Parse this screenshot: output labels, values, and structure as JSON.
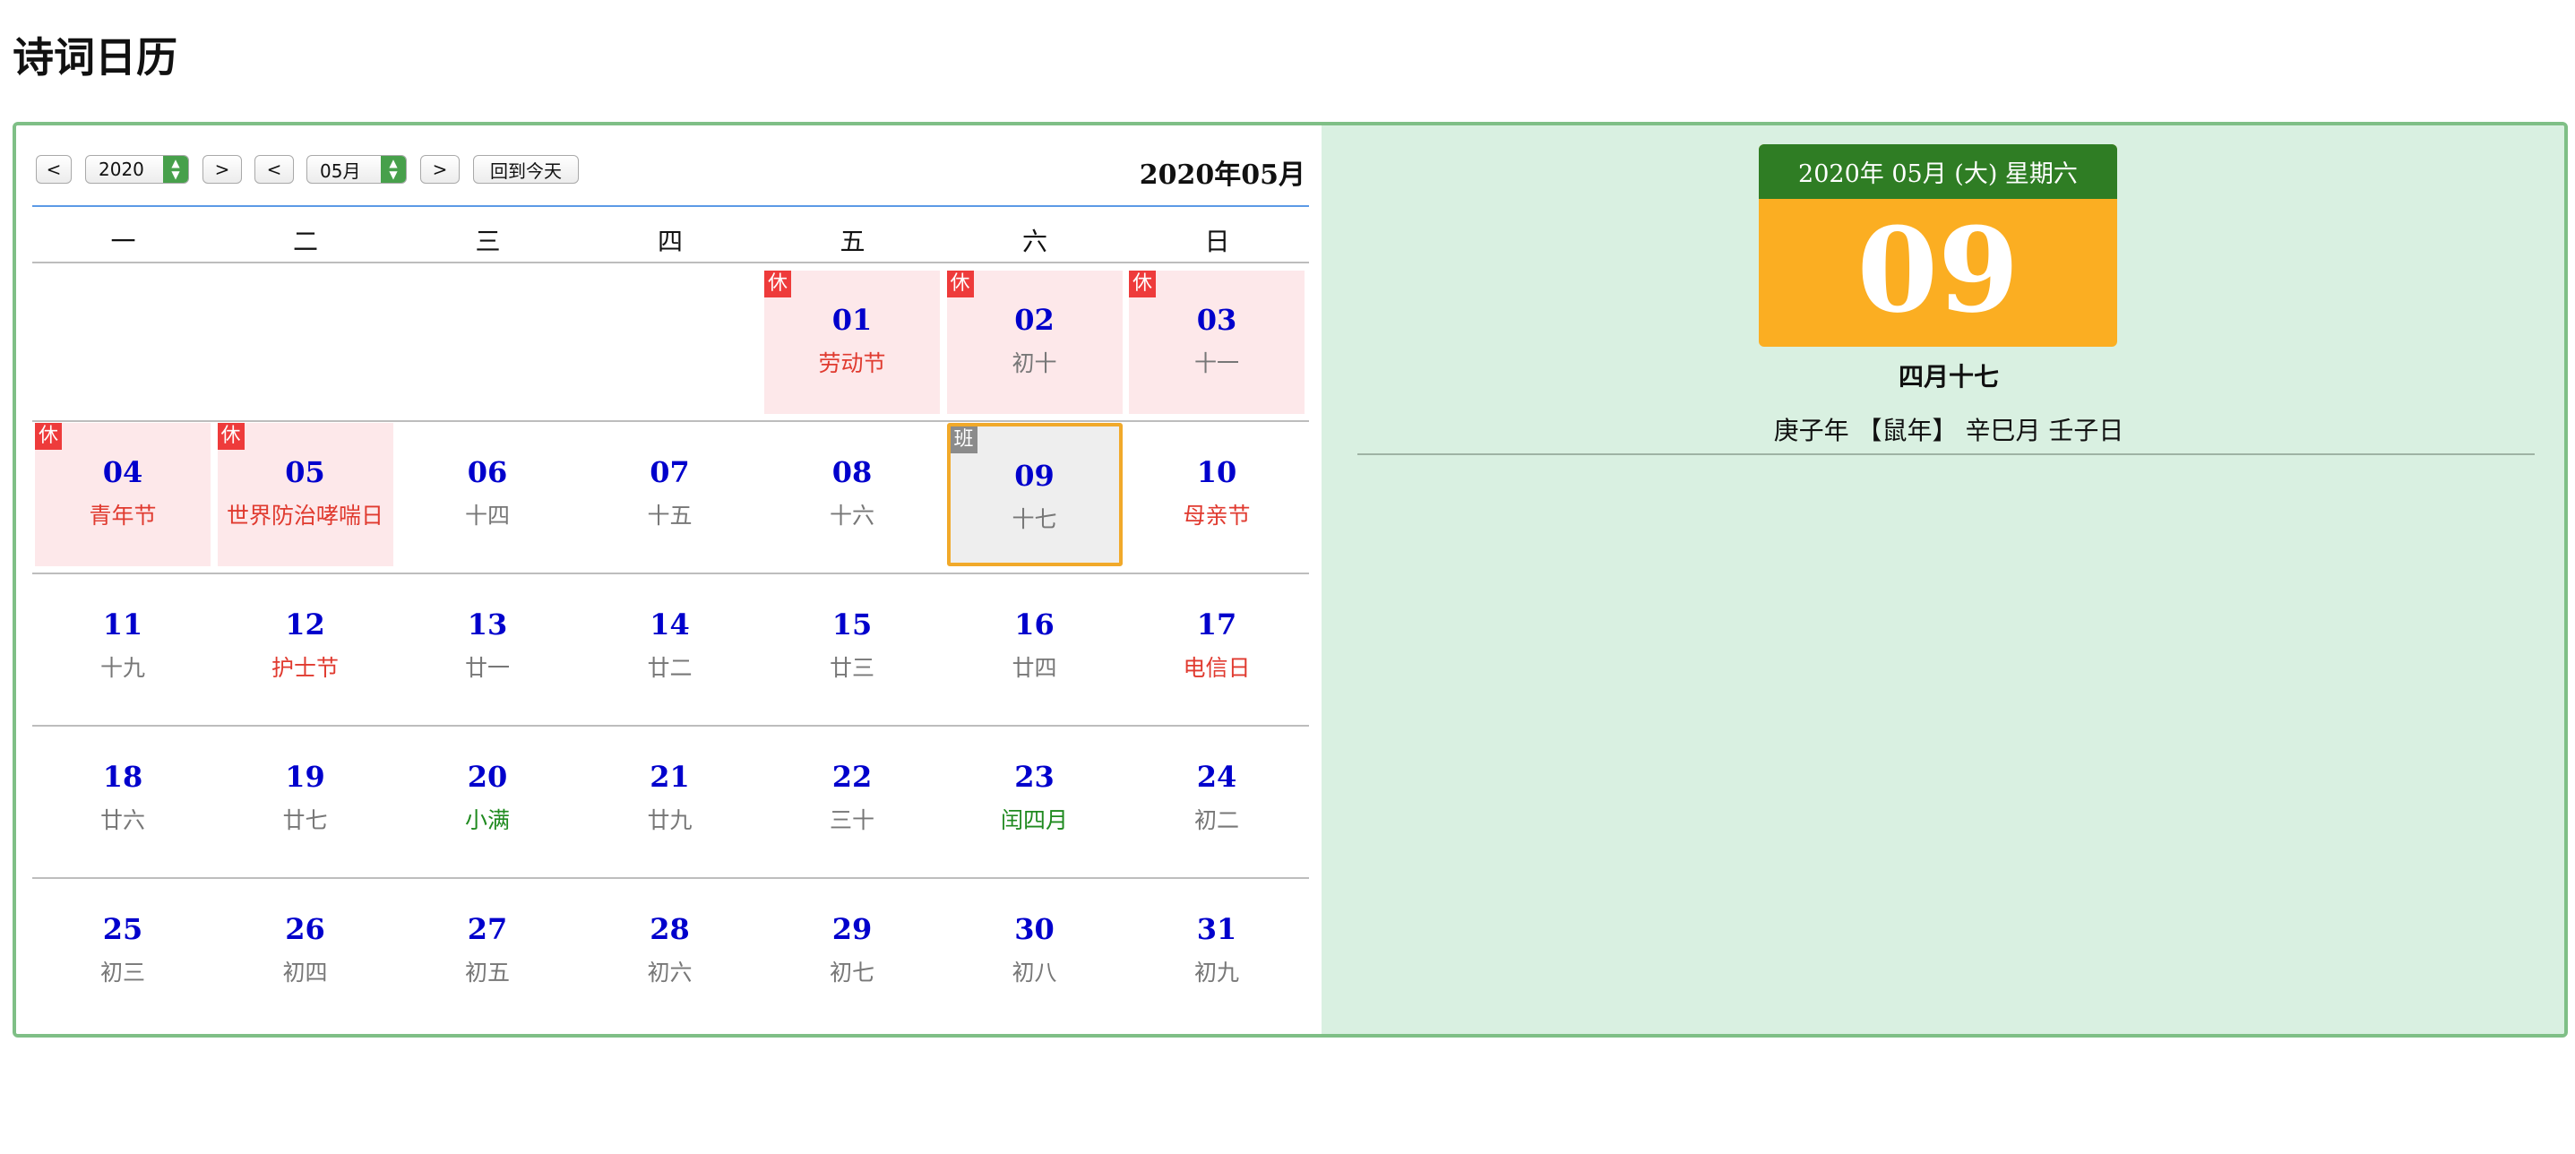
{
  "page": {
    "title": "诗词日历"
  },
  "toolbar": {
    "prev_year": "<",
    "year_value": "2020",
    "next_year": ">",
    "prev_month": "<",
    "month_value": "05月",
    "next_month": ">",
    "today_button": "回到今天"
  },
  "calendar": {
    "month_title": "2020年05月",
    "weekdays": [
      "一",
      "二",
      "三",
      "四",
      "五",
      "六",
      "日"
    ],
    "weeks": [
      [
        null,
        null,
        null,
        null,
        {
          "day": "01",
          "sub": "劳动节",
          "style": "red",
          "badge": "休",
          "holiday": true
        },
        {
          "day": "02",
          "sub": "初十",
          "style": "gray",
          "badge": "休",
          "holiday": true
        },
        {
          "day": "03",
          "sub": "十一",
          "style": "gray",
          "badge": "休",
          "holiday": true
        }
      ],
      [
        {
          "day": "04",
          "sub": "青年节",
          "style": "red",
          "badge": "休",
          "holiday": true
        },
        {
          "day": "05",
          "sub": "世界防治哮喘日",
          "style": "red",
          "badge": "休",
          "holiday": true
        },
        {
          "day": "06",
          "sub": "十四",
          "style": "gray"
        },
        {
          "day": "07",
          "sub": "十五",
          "style": "gray"
        },
        {
          "day": "08",
          "sub": "十六",
          "style": "gray"
        },
        {
          "day": "09",
          "sub": "十七",
          "style": "gray",
          "badge": "班",
          "today": true
        },
        {
          "day": "10",
          "sub": "母亲节",
          "style": "red"
        }
      ],
      [
        {
          "day": "11",
          "sub": "十九",
          "style": "gray"
        },
        {
          "day": "12",
          "sub": "护士节",
          "style": "red"
        },
        {
          "day": "13",
          "sub": "廿一",
          "style": "gray"
        },
        {
          "day": "14",
          "sub": "廿二",
          "style": "gray"
        },
        {
          "day": "15",
          "sub": "廿三",
          "style": "gray"
        },
        {
          "day": "16",
          "sub": "廿四",
          "style": "gray"
        },
        {
          "day": "17",
          "sub": "电信日",
          "style": "red"
        }
      ],
      [
        {
          "day": "18",
          "sub": "廿六",
          "style": "gray"
        },
        {
          "day": "19",
          "sub": "廿七",
          "style": "gray"
        },
        {
          "day": "20",
          "sub": "小满",
          "style": "green"
        },
        {
          "day": "21",
          "sub": "廿九",
          "style": "gray"
        },
        {
          "day": "22",
          "sub": "三十",
          "style": "gray"
        },
        {
          "day": "23",
          "sub": "闰四月",
          "style": "green"
        },
        {
          "day": "24",
          "sub": "初二",
          "style": "gray"
        }
      ],
      [
        {
          "day": "25",
          "sub": "初三",
          "style": "gray"
        },
        {
          "day": "26",
          "sub": "初四",
          "style": "gray"
        },
        {
          "day": "27",
          "sub": "初五",
          "style": "gray"
        },
        {
          "day": "28",
          "sub": "初六",
          "style": "gray"
        },
        {
          "day": "29",
          "sub": "初七",
          "style": "gray"
        },
        {
          "day": "30",
          "sub": "初八",
          "style": "gray"
        },
        {
          "day": "31",
          "sub": "初九",
          "style": "gray"
        }
      ]
    ]
  },
  "detail": {
    "header": "2020年 05月 (大) 星期六",
    "day": "09",
    "lunar": "四月十七",
    "ganzhi": "庚子年 【鼠年】 辛巳月 壬子日"
  },
  "colors": {
    "holiday_bg": "#fde8ea",
    "rest_badge": "#ee3b3b",
    "work_badge": "#8b8b8b",
    "today_border": "#f1a92a",
    "detail_header": "#2f7d24",
    "detail_day_bg": "#fbae22",
    "right_panel_bg": "#d9f0e1",
    "day_number": "#0000cc"
  }
}
